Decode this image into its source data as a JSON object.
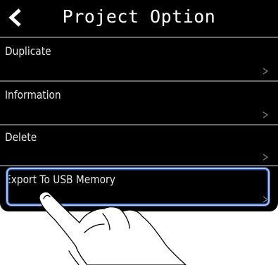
{
  "header": {
    "back_icon": "chevron-left-icon",
    "title": "Project Option"
  },
  "menu": {
    "items": [
      {
        "label": "Duplicate",
        "chevron": ">"
      },
      {
        "label": "Information",
        "chevron": ">"
      },
      {
        "label": "Delete",
        "chevron": ">"
      },
      {
        "label": "Export To USB Memory",
        "chevron": ">",
        "selected": true
      }
    ]
  },
  "colors": {
    "screen_background": "#000000",
    "text": "#e8e8e8",
    "divider": "#6a6a6a",
    "highlight_border": "#a9c5ee",
    "highlight_outline": "#2b4f9a"
  },
  "overlay": {
    "icon": "pointing-hand-icon"
  }
}
